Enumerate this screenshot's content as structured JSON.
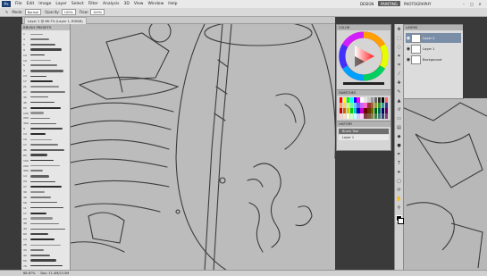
{
  "app": {
    "logo": "Ps"
  },
  "menubar": {
    "items": [
      "File",
      "Edit",
      "Image",
      "Layer",
      "Select",
      "Filter",
      "Analysis",
      "3D",
      "View",
      "Window",
      "Help"
    ],
    "workspace": [
      "DESIGN",
      "PAINTING",
      "PHOTOGRAPHY"
    ],
    "window_controls": [
      "–",
      "□",
      "✕"
    ]
  },
  "options": {
    "mode_label": "Mode:",
    "mode_value": "Normal",
    "opacity_label": "Opacity:",
    "opacity_value": "100%",
    "flow_label": "Flow:",
    "flow_value": "100%"
  },
  "document": {
    "tab_title": "Layer 1 @ 66.7% (Layer 1, RGB/8)"
  },
  "brushes": {
    "title": "BRUSH PRESETS",
    "sizes": [
      "1",
      "3",
      "5",
      "9",
      "13",
      "19",
      "5",
      "9",
      "13",
      "17",
      "21",
      "27",
      "35",
      "45",
      "65",
      "100",
      "200",
      "300",
      "9",
      "13",
      "19",
      "17",
      "45",
      "65",
      "100",
      "200",
      "300",
      "14",
      "24",
      "27",
      "39",
      "46",
      "59",
      "11",
      "17",
      "23",
      "36",
      "44",
      "60",
      "14",
      "26",
      "33",
      "42",
      "55",
      "70"
    ]
  },
  "colors": {
    "title": "COLOR"
  },
  "swatches": {
    "title": "SWATCHES",
    "colors": [
      "#ff0000",
      "#ffff00",
      "#00ff00",
      "#00ffff",
      "#0000ff",
      "#ff00ff",
      "#ffffff",
      "#e6e6e6",
      "#cccccc",
      "#999999",
      "#666666",
      "#333333",
      "#000000",
      "#ff6666",
      "#ff9966",
      "#ffcc66",
      "#ccff66",
      "#66ff99",
      "#66ccff",
      "#6666ff",
      "#cc66ff",
      "#ff66cc",
      "#993333",
      "#996633",
      "#999933",
      "#339933",
      "#339999",
      "#333399",
      "#cc0000",
      "#cc6600",
      "#cccc00",
      "#00cc00",
      "#00cccc",
      "#0000cc",
      "#cc00cc",
      "#660000",
      "#663300",
      "#666600",
      "#006600",
      "#006666",
      "#000066",
      "#660066",
      "#ffcccc",
      "#ffe0cc",
      "#ffffcc",
      "#ccffcc",
      "#ccffff",
      "#ccccff",
      "#ffccff",
      "#804040",
      "#805a40",
      "#808040",
      "#408040",
      "#408080",
      "#404080",
      "#804080"
    ]
  },
  "history": {
    "title": "HISTORY",
    "items": [
      "Brush Tool",
      "Layer 1"
    ]
  },
  "layers": {
    "title": "LAYERS",
    "items": [
      {
        "name": "Layer 2",
        "selected": true
      },
      {
        "name": "Layer 1",
        "selected": false
      },
      {
        "name": "Background",
        "selected": false
      }
    ]
  },
  "status": {
    "zoom": "66.67%",
    "doc": "Doc: 11.4M/23.5M"
  }
}
